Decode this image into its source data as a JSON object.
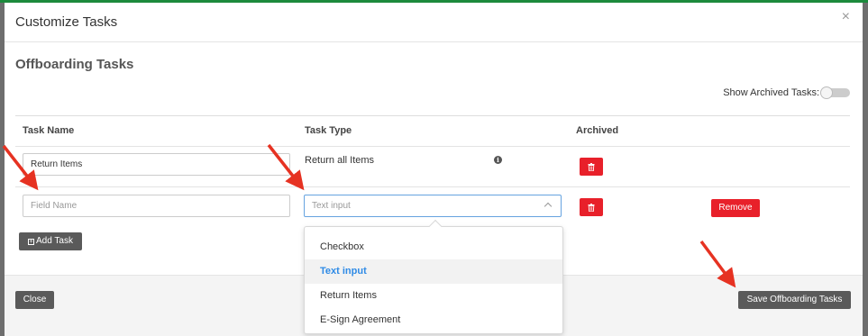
{
  "modal": {
    "title": "Customize Tasks",
    "close_glyph": "×"
  },
  "section": {
    "title": "Offboarding Tasks",
    "show_archived_label": "Show Archived Tasks:",
    "show_archived_on": false
  },
  "table": {
    "columns": [
      "Task Name",
      "Task Type",
      "Archived"
    ],
    "rows": [
      {
        "name_value": "Return Items",
        "type_text": "Return all Items",
        "info_icon": "info-icon"
      },
      {
        "name_placeholder": "Field Name",
        "type_placeholder": "Text input",
        "remove_label": "Remove"
      }
    ]
  },
  "buttons": {
    "add_task": "Add Task",
    "close": "Close",
    "save": "Save Offboarding Tasks"
  },
  "dropdown": {
    "options": [
      "Checkbox",
      "Text input",
      "Return Items",
      "E-Sign Agreement"
    ],
    "selected": "Text input"
  },
  "colors": {
    "danger": "#e8202a",
    "secondary": "#5a5a5a",
    "accent": "#2f8be6",
    "annotation_arrow": "#e63222"
  }
}
